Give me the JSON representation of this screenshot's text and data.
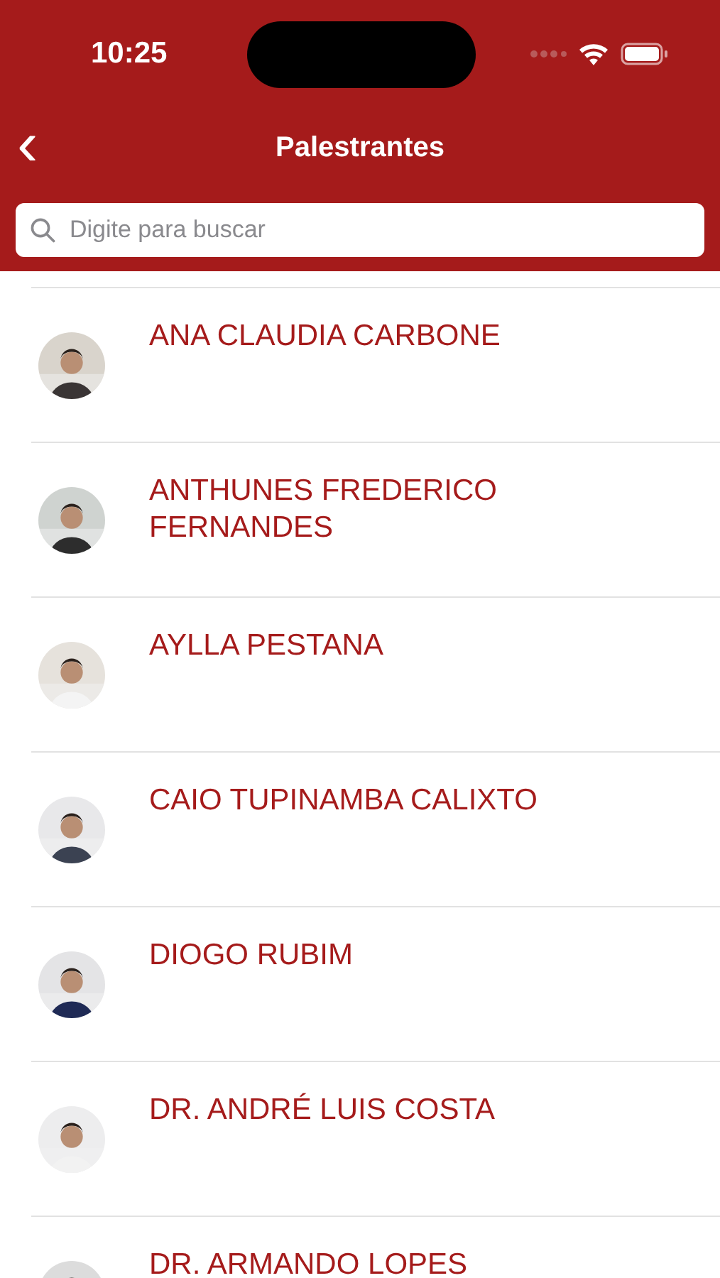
{
  "status_bar": {
    "time": "10:25"
  },
  "nav": {
    "back": "‹",
    "title": "Palestrantes"
  },
  "search": {
    "placeholder": "Digite para buscar"
  },
  "speakers": [
    {
      "name": "ANA CLAUDIA CARBONE"
    },
    {
      "name": "ANTHUNES FREDERICO FERNANDES"
    },
    {
      "name": "AYLLA PESTANA"
    },
    {
      "name": "CAIO TUPINAMBA CALIXTO"
    },
    {
      "name": "DIOGO RUBIM"
    },
    {
      "name": "DR. ANDRÉ LUIS COSTA"
    },
    {
      "name": "DR. ARMANDO LOPES"
    }
  ]
}
